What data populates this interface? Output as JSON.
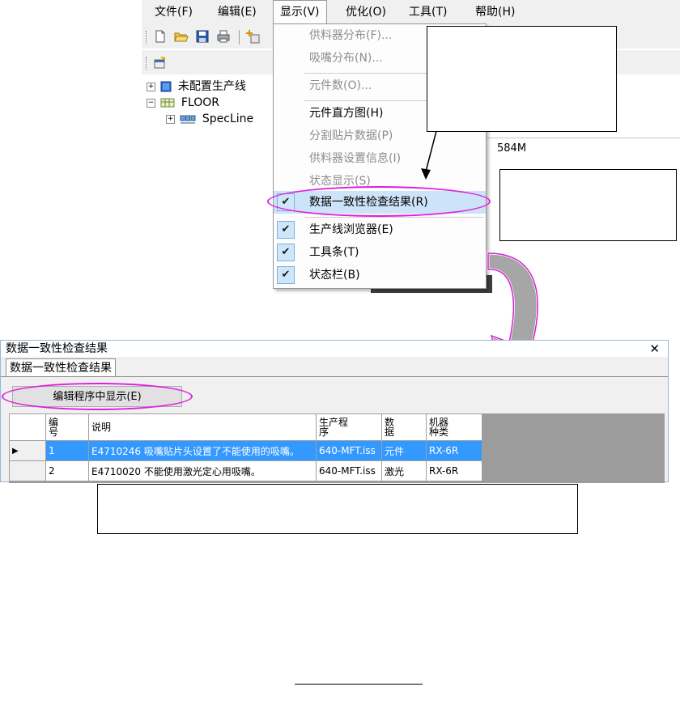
{
  "menubar": {
    "items": [
      "文件(F)",
      "编辑(E)",
      "显示(V)",
      "优化(O)",
      "工具(T)",
      "帮助(H)"
    ],
    "open_index": 2
  },
  "tree": {
    "items": [
      {
        "label": "未配置生产线"
      },
      {
        "label": "FLOOR"
      },
      {
        "label": "SpecLine"
      }
    ]
  },
  "background_cell": "584M",
  "dropdown": {
    "items": [
      {
        "label": "供料器分布(F)...",
        "disabled": true,
        "checked": false
      },
      {
        "label": "吸嘴分布(N)...",
        "disabled": true,
        "checked": false
      },
      {
        "label": "元件数(O)...",
        "disabled": true,
        "checked": false
      },
      {
        "label": "元件直方图(H)",
        "disabled": false,
        "checked": false
      },
      {
        "label": "分割贴片数据(P)",
        "disabled": true,
        "checked": false
      },
      {
        "label": "供料器设置信息(I)",
        "disabled": true,
        "checked": false
      },
      {
        "label": "状态显示(S)",
        "disabled": true,
        "checked": false
      },
      {
        "label": "数据一致性检查结果(R)",
        "disabled": false,
        "checked": true,
        "highlighted": true
      },
      {
        "label": "生产线浏览器(E)",
        "disabled": false,
        "checked": true
      },
      {
        "label": "工具条(T)",
        "disabled": false,
        "checked": true
      },
      {
        "label": "状态栏(B)",
        "disabled": false,
        "checked": true
      }
    ]
  },
  "dialog": {
    "title": "数据一致性检查结果",
    "close": "✕",
    "tab": "数据一致性检查结果",
    "button": "编辑程序中显示(E)",
    "columns": [
      "",
      "编号",
      "说明",
      "生产程序",
      "数据",
      "机器种类"
    ],
    "column_lines": [
      [
        "编",
        "号"
      ],
      [
        "说明"
      ],
      [
        "生产程",
        "序"
      ],
      [
        "数",
        "据"
      ],
      [
        "机器",
        "种类"
      ]
    ],
    "rows": [
      {
        "selected": true,
        "indicator": "▶",
        "no": "1",
        "desc": "E4710246 吸嘴贴片头设置了不能使用的吸嘴。",
        "program": "640-MFT.iss",
        "data": "元件",
        "machine": "RX-6R"
      },
      {
        "selected": false,
        "indicator": "",
        "no": "2",
        "desc": "E4710020 不能使用激光定心用吸嘴。",
        "program": "640-MFT.iss",
        "data": "激光",
        "machine": "RX-6R"
      }
    ]
  },
  "colors": {
    "highlight_ellipse": "#e01ee0",
    "selection": "#3399ff",
    "menu_check": "#cfe6fa",
    "arrow_fill": "#a6a6a6"
  }
}
